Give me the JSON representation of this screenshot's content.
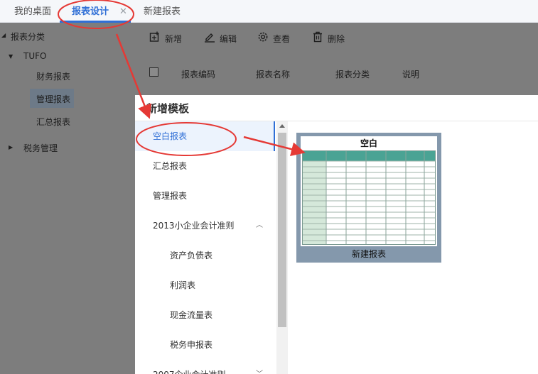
{
  "tabs": [
    {
      "label": "我的桌面"
    },
    {
      "label": "报表设计"
    },
    {
      "label": "新建报表"
    }
  ],
  "tab_close": "✕",
  "sidebar": {
    "root": "报表分类",
    "group": "TUFO",
    "items": [
      "财务报表",
      "管理报表",
      "汇总报表"
    ],
    "group2": "税务管理"
  },
  "toolbar": {
    "add": "新增",
    "edit": "编辑",
    "view": "查看",
    "delete": "删除"
  },
  "table_headers": [
    "报表编码",
    "报表名称",
    "报表分类",
    "说明"
  ],
  "dialog": {
    "title": "新增模板",
    "menu": [
      {
        "label": "空白报表"
      },
      {
        "label": "汇总报表"
      },
      {
        "label": "管理报表"
      },
      {
        "label": "2013小企业会计准则"
      },
      {
        "label": "资产负债表"
      },
      {
        "label": "利润表"
      },
      {
        "label": "现金流量表"
      },
      {
        "label": "税务申报表"
      },
      {
        "label": "2007企业会计准则"
      }
    ],
    "template": {
      "name": "空白",
      "caption": "新建报表"
    }
  },
  "colors": {
    "accent": "#2f6fd6",
    "annotation": "#e53935",
    "grid_header": "#4aa394"
  }
}
